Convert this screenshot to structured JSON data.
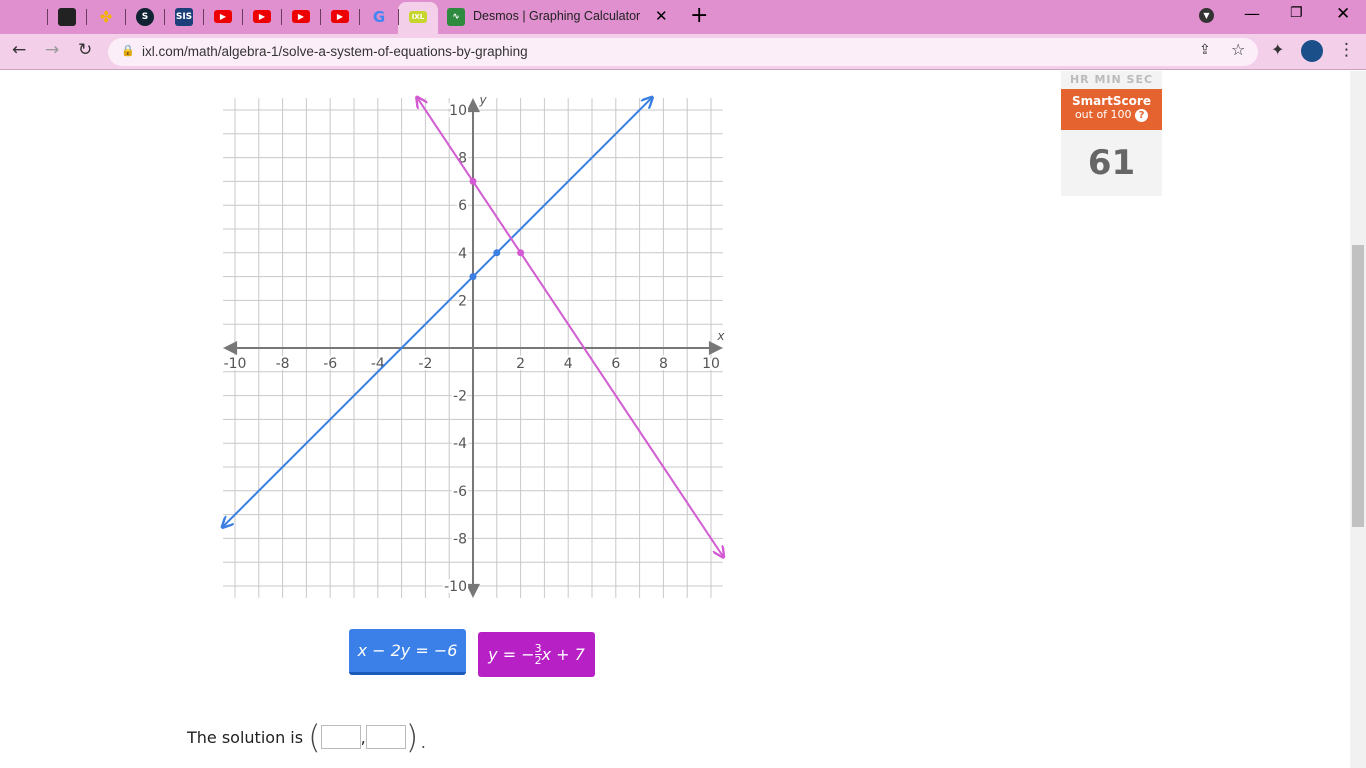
{
  "browser": {
    "tabs": [
      {
        "icon": "cf-icon",
        "color": "#222"
      },
      {
        "icon": "pinwheel-icon",
        "color": "#f4b400"
      },
      {
        "icon": "s-icon",
        "color": "#123"
      },
      {
        "icon": "sis-icon",
        "label": "SIS",
        "color": "#1c3f7a"
      },
      {
        "icon": "youtube-icon",
        "color": "#e00"
      },
      {
        "icon": "youtube-icon",
        "color": "#e00"
      },
      {
        "icon": "youtube-icon",
        "color": "#e00"
      },
      {
        "icon": "youtube-icon",
        "color": "#e00"
      },
      {
        "icon": "google-icon",
        "label": "G",
        "color": "#4285f4"
      },
      {
        "icon": "ixl-icon",
        "label": "IXL",
        "color": "#c7d62d"
      }
    ],
    "desmos_tab_title": "Desmos | Graphing Calculator",
    "url": "ixl.com/math/algebra-1/solve-a-system-of-equations-by-graphing"
  },
  "score": {
    "timer_labels": "HR  MIN  SEC",
    "title": "SmartScore",
    "subtitle": "out of 100",
    "help": "?",
    "value": "61"
  },
  "graph": {
    "x_label": "x",
    "y_label": "y",
    "x_ticks": [
      "-10",
      "-8",
      "-6",
      "-4",
      "-2",
      "2",
      "4",
      "6",
      "8",
      "10"
    ],
    "y_ticks": [
      "10",
      "8",
      "6",
      "4",
      "2",
      "-2",
      "-4",
      "-6",
      "-8",
      "-10"
    ],
    "range": [
      -10.5,
      10.5
    ],
    "lines": [
      {
        "name": "blue-line",
        "color": "#3b7fe0",
        "slope": 1,
        "intercept": 3,
        "points": [
          [
            0,
            3
          ],
          [
            1,
            4
          ]
        ]
      },
      {
        "name": "pink-line",
        "color": "#d35ad3",
        "slope": -1.5,
        "intercept": 7,
        "points": [
          [
            0,
            7
          ],
          [
            2,
            4
          ]
        ]
      }
    ]
  },
  "equations": {
    "blue": "x − 2y = −6",
    "blue_color": "#3a80e8",
    "pink_prefix": "y = −",
    "pink_num": "3",
    "pink_den": "2",
    "pink_suffix": "x + 7",
    "pink_color": "#b620c4"
  },
  "solution": {
    "label": "The solution is",
    "open": "(",
    "comma": ",",
    "close": ")."
  }
}
